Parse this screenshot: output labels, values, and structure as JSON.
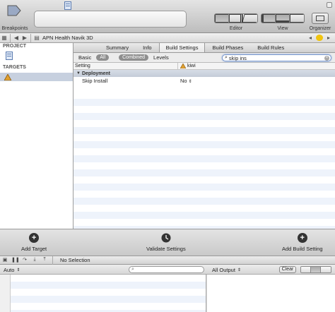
{
  "toolbar": {
    "breakpoints_label": "Breakpoints",
    "editor_label": "Editor",
    "view_label": "View",
    "organizer_label": "Organizer"
  },
  "jumpbar": {
    "project_name": "APN Health Navik 3D"
  },
  "navigator": {
    "project_header": "PROJECT",
    "targets_header": "TARGETS"
  },
  "editor": {
    "tabs": [
      {
        "label": "Summary",
        "active": false
      },
      {
        "label": "Info",
        "active": false
      },
      {
        "label": "Build Settings",
        "active": true
      },
      {
        "label": "Build Phases",
        "active": false
      },
      {
        "label": "Build Rules",
        "active": false
      }
    ],
    "filters": {
      "basic": "Basic",
      "all": "All",
      "combined": "Combined",
      "levels": "Levels"
    },
    "search_value": "skip ins",
    "columns": {
      "setting": "Setting",
      "target": "kiwi"
    },
    "section": "Deployment",
    "rows": [
      {
        "setting": "Skip Install",
        "value": "No"
      }
    ]
  },
  "bottombar": {
    "add_target": "Add Target",
    "validate": "Validate Settings",
    "add_build_setting": "Add Build Setting"
  },
  "debugbar": {
    "status": "No Selection"
  },
  "console": {
    "auto_label": "Auto",
    "output_label": "All Output",
    "clear_label": "Clear"
  },
  "colors": {
    "selection": "#c7d0df",
    "stripe": "#eef3fb",
    "search_focus": "#7b9ad0"
  }
}
